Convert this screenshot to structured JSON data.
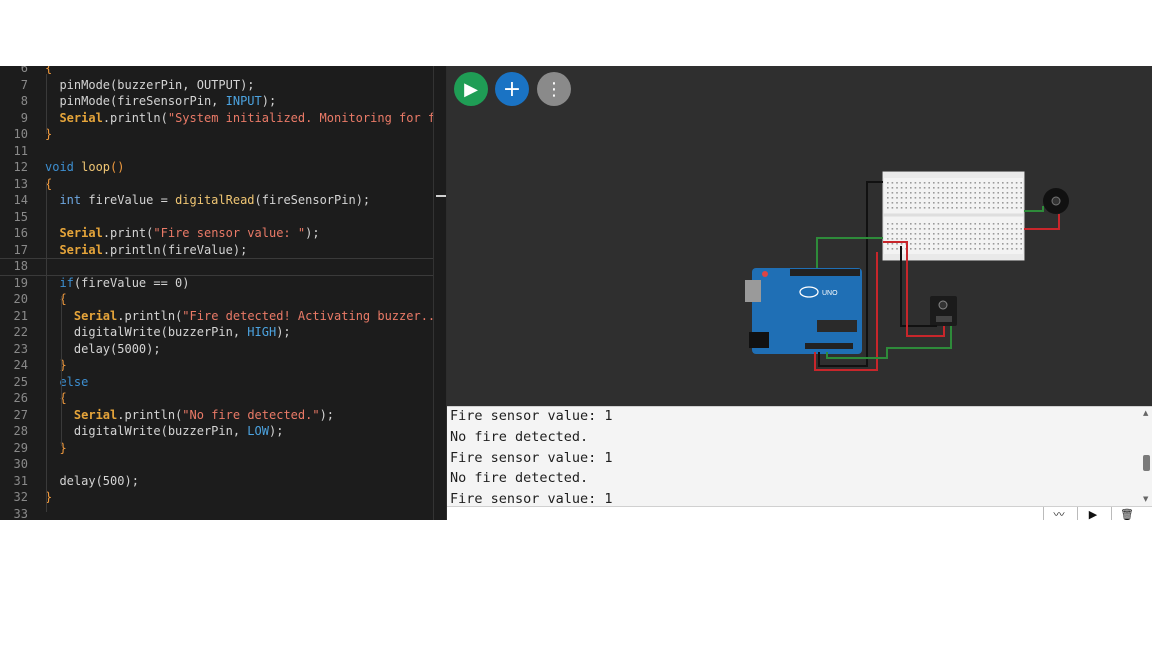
{
  "editor": {
    "lines": [
      {
        "n": "6",
        "segments": [
          {
            "t": "{",
            "c": "br"
          }
        ]
      },
      {
        "n": "7",
        "segments": [
          {
            "t": "  pinMode(buzzerPin, OUTPUT);",
            "c": ""
          }
        ]
      },
      {
        "n": "8",
        "segments": [
          {
            "t": "  pinMode(fireSensorPin, ",
            "c": ""
          },
          {
            "t": "INPUT",
            "c": "con"
          },
          {
            "t": ");",
            "c": ""
          }
        ]
      },
      {
        "n": "9",
        "segments": [
          {
            "t": "  ",
            "c": ""
          },
          {
            "t": "Serial",
            "c": "cls"
          },
          {
            "t": ".println(",
            "c": ""
          },
          {
            "t": "\"System initialized. Monitoring for fi",
            "c": "str"
          }
        ]
      },
      {
        "n": "10",
        "segments": [
          {
            "t": "}",
            "c": "br"
          }
        ]
      },
      {
        "n": "11",
        "segments": []
      },
      {
        "n": "12",
        "segments": [
          {
            "t": "void",
            "c": "kw"
          },
          {
            "t": " loop",
            "c": "fn"
          },
          {
            "t": "()",
            "c": "br"
          }
        ]
      },
      {
        "n": "13",
        "segments": [
          {
            "t": "{",
            "c": "br"
          }
        ]
      },
      {
        "n": "14",
        "segments": [
          {
            "t": "  ",
            "c": ""
          },
          {
            "t": "int",
            "c": "ty"
          },
          {
            "t": " fireValue = ",
            "c": ""
          },
          {
            "t": "digitalRead",
            "c": "fn"
          },
          {
            "t": "(fireSensorPin);",
            "c": ""
          }
        ]
      },
      {
        "n": "15",
        "segments": []
      },
      {
        "n": "16",
        "segments": [
          {
            "t": "  ",
            "c": ""
          },
          {
            "t": "Serial",
            "c": "cls"
          },
          {
            "t": ".print(",
            "c": ""
          },
          {
            "t": "\"Fire sensor value: \"",
            "c": "str"
          },
          {
            "t": ");",
            "c": ""
          }
        ]
      },
      {
        "n": "17",
        "segments": [
          {
            "t": "  ",
            "c": ""
          },
          {
            "t": "Serial",
            "c": "cls"
          },
          {
            "t": ".println(fireValue);",
            "c": ""
          }
        ]
      },
      {
        "n": "18",
        "segments": []
      },
      {
        "n": "19",
        "segments": [
          {
            "t": "  ",
            "c": ""
          },
          {
            "t": "if",
            "c": "kw"
          },
          {
            "t": "(fireValue == 0)",
            "c": ""
          }
        ]
      },
      {
        "n": "20",
        "segments": [
          {
            "t": "  {",
            "c": "br"
          }
        ]
      },
      {
        "n": "21",
        "segments": [
          {
            "t": "    ",
            "c": ""
          },
          {
            "t": "Serial",
            "c": "cls"
          },
          {
            "t": ".println(",
            "c": ""
          },
          {
            "t": "\"Fire detected! Activating buzzer...",
            "c": "str"
          }
        ]
      },
      {
        "n": "22",
        "segments": [
          {
            "t": "    digitalWrite(buzzerPin, ",
            "c": ""
          },
          {
            "t": "HIGH",
            "c": "con"
          },
          {
            "t": ");",
            "c": ""
          }
        ]
      },
      {
        "n": "23",
        "segments": [
          {
            "t": "    delay(5000);",
            "c": ""
          }
        ]
      },
      {
        "n": "24",
        "segments": [
          {
            "t": "  }",
            "c": "br"
          }
        ]
      },
      {
        "n": "25",
        "segments": [
          {
            "t": "  ",
            "c": ""
          },
          {
            "t": "else",
            "c": "kw"
          }
        ]
      },
      {
        "n": "26",
        "segments": [
          {
            "t": "  {",
            "c": "br"
          }
        ]
      },
      {
        "n": "27",
        "segments": [
          {
            "t": "    ",
            "c": ""
          },
          {
            "t": "Serial",
            "c": "cls"
          },
          {
            "t": ".println(",
            "c": ""
          },
          {
            "t": "\"No fire detected.\"",
            "c": "str"
          },
          {
            "t": ");",
            "c": ""
          }
        ]
      },
      {
        "n": "28",
        "segments": [
          {
            "t": "    digitalWrite(buzzerPin, ",
            "c": ""
          },
          {
            "t": "LOW",
            "c": "con"
          },
          {
            "t": ");",
            "c": ""
          }
        ]
      },
      {
        "n": "29",
        "segments": [
          {
            "t": "  }",
            "c": "br"
          }
        ]
      },
      {
        "n": "30",
        "segments": []
      },
      {
        "n": "31",
        "segments": [
          {
            "t": "  delay(500);",
            "c": ""
          }
        ]
      },
      {
        "n": "32",
        "segments": [
          {
            "t": "}",
            "c": "br"
          }
        ]
      },
      {
        "n": "33",
        "segments": []
      }
    ],
    "current_line": "18"
  },
  "toolbar": {
    "play_icon": "play-icon",
    "add_icon": "plus-icon",
    "more_icon": "more-vertical-icon",
    "play_glyph": "▶",
    "add_glyph": "+",
    "more_glyph": "⋮"
  },
  "circuit": {
    "board_label": "UNO",
    "board_color": "#1f6fb5",
    "breadboard_color": "#f2f2f2",
    "wire_red": "#c8262b",
    "wire_green": "#2e8b3a",
    "wire_black": "#111111"
  },
  "serial": {
    "lines": [
      "Fire sensor value: 1",
      "No fire detected.",
      "Fire sensor value: 1",
      "No fire detected.",
      "Fire sensor value: 1"
    ],
    "tools": [
      {
        "name": "plotter-icon",
        "glyph": "〰"
      },
      {
        "name": "play-icon",
        "glyph": "▶"
      },
      {
        "name": "trash-icon",
        "glyph": "🗑"
      }
    ]
  }
}
